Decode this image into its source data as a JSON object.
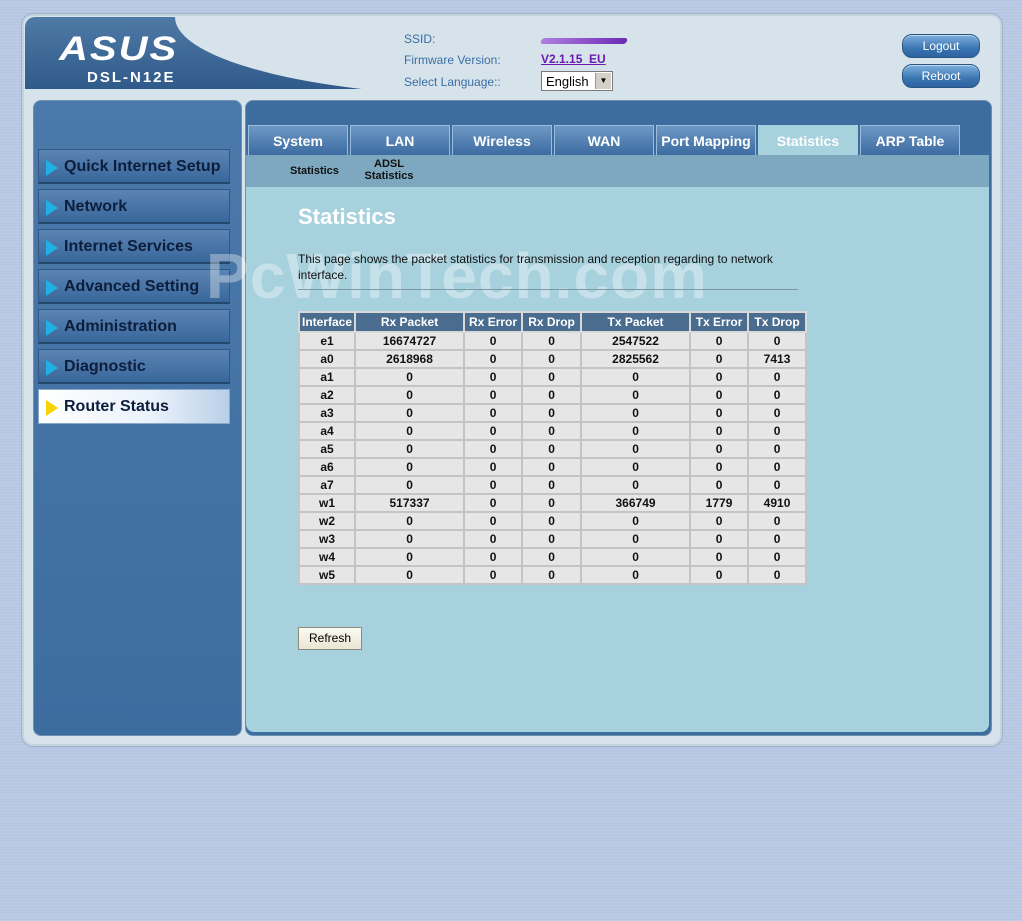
{
  "header": {
    "brand": "ASUS",
    "model": "DSL-N12E",
    "ssid_label": "SSID:",
    "firmware_label": "Firmware Version:",
    "firmware_value": "V2.1.15_EU",
    "language_label": "Select Language::",
    "language_value": "English",
    "logout_label": "Logout",
    "reboot_label": "Reboot"
  },
  "sidebar": {
    "items": [
      {
        "label": "Quick Internet Setup"
      },
      {
        "label": "Network"
      },
      {
        "label": "Internet Services"
      },
      {
        "label": "Advanced Setting"
      },
      {
        "label": "Administration"
      },
      {
        "label": "Diagnostic"
      },
      {
        "label": "Router Status"
      }
    ],
    "active": "Router Status"
  },
  "tabs": [
    {
      "label": "System"
    },
    {
      "label": "LAN"
    },
    {
      "label": "Wireless"
    },
    {
      "label": "WAN"
    },
    {
      "label": "Port Mapping"
    },
    {
      "label": "Statistics"
    },
    {
      "label": "ARP Table"
    }
  ],
  "active_tab": "Statistics",
  "subtabs": [
    {
      "label": "Statistics"
    },
    {
      "label_line1": "ADSL",
      "label_line2": "Statistics"
    }
  ],
  "page": {
    "title": "Statistics",
    "description": "This page shows the packet statistics for transmission and reception regarding to network interface.",
    "watermark": "PcWinTech.com",
    "refresh_label": "Refresh"
  },
  "table": {
    "headers": [
      "Interface",
      "Rx Packet",
      "Rx Error",
      "Rx Drop",
      "Tx Packet",
      "Tx Error",
      "Tx Drop"
    ],
    "rows": [
      [
        "e1",
        "16674727",
        "0",
        "0",
        "2547522",
        "0",
        "0"
      ],
      [
        "a0",
        "2618968",
        "0",
        "0",
        "2825562",
        "0",
        "7413"
      ],
      [
        "a1",
        "0",
        "0",
        "0",
        "0",
        "0",
        "0"
      ],
      [
        "a2",
        "0",
        "0",
        "0",
        "0",
        "0",
        "0"
      ],
      [
        "a3",
        "0",
        "0",
        "0",
        "0",
        "0",
        "0"
      ],
      [
        "a4",
        "0",
        "0",
        "0",
        "0",
        "0",
        "0"
      ],
      [
        "a5",
        "0",
        "0",
        "0",
        "0",
        "0",
        "0"
      ],
      [
        "a6",
        "0",
        "0",
        "0",
        "0",
        "0",
        "0"
      ],
      [
        "a7",
        "0",
        "0",
        "0",
        "0",
        "0",
        "0"
      ],
      [
        "w1",
        "517337",
        "0",
        "0",
        "366749",
        "1779",
        "4910"
      ],
      [
        "w2",
        "0",
        "0",
        "0",
        "0",
        "0",
        "0"
      ],
      [
        "w3",
        "0",
        "0",
        "0",
        "0",
        "0",
        "0"
      ],
      [
        "w4",
        "0",
        "0",
        "0",
        "0",
        "0",
        "0"
      ],
      [
        "w5",
        "0",
        "0",
        "0",
        "0",
        "0",
        "0"
      ]
    ]
  }
}
